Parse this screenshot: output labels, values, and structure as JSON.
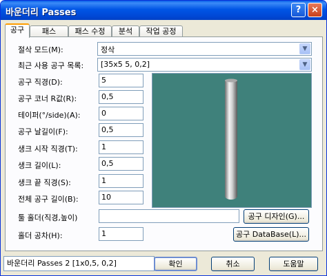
{
  "window": {
    "title": "바운더리 Passes"
  },
  "titlebar_buttons": {
    "help": "?",
    "close": "×"
  },
  "tabs": [
    "공구",
    "패스",
    "패스 수정",
    "분석",
    "작업 공정"
  ],
  "fields": {
    "cut_mode_label": "절삭 모드(M):",
    "cut_mode_value": "정삭",
    "recent_tools_label": "최근 사용 공구 목록:",
    "recent_tools_value": "[35x5 5, 0,2]",
    "tool_diameter_label": "공구 직경(D):",
    "tool_diameter_value": "5",
    "corner_r_label": "공구 코너 R값(R):",
    "corner_r_value": "0,5",
    "taper_label": "테이퍼(°/side)(A):",
    "taper_value": "0",
    "flute_length_label": "공구 날길이(F):",
    "flute_length_value": "0,5",
    "shank_start_label": "생크 시작 직경(T):",
    "shank_start_value": "1",
    "shank_length_label": "생크 길이(L):",
    "shank_length_value": "0,5",
    "shank_end_label": "생크 끝 직경(S):",
    "shank_end_value": "1",
    "total_length_label": "전체 공구 길이(B):",
    "total_length_value": "10",
    "holder_label": "툴 홀더(직경,높이)",
    "holder_value": "",
    "holder_tol_label": "홀더 공차(H):",
    "holder_tol_value": "1"
  },
  "buttons": {
    "tool_design": "공구 디자인(G)...",
    "tool_database": "공구 DataBase(L)...",
    "ok": "확인",
    "cancel": "취소",
    "help": "도움말"
  },
  "status": "바운더리 Passes 2 [1x0,5, 0,2]",
  "colors": {
    "titlebar": "#0055e5",
    "dialog_bg": "#ece9d8",
    "preview_bg": "#3f817b",
    "tool_metal": "#c0c0c0"
  }
}
